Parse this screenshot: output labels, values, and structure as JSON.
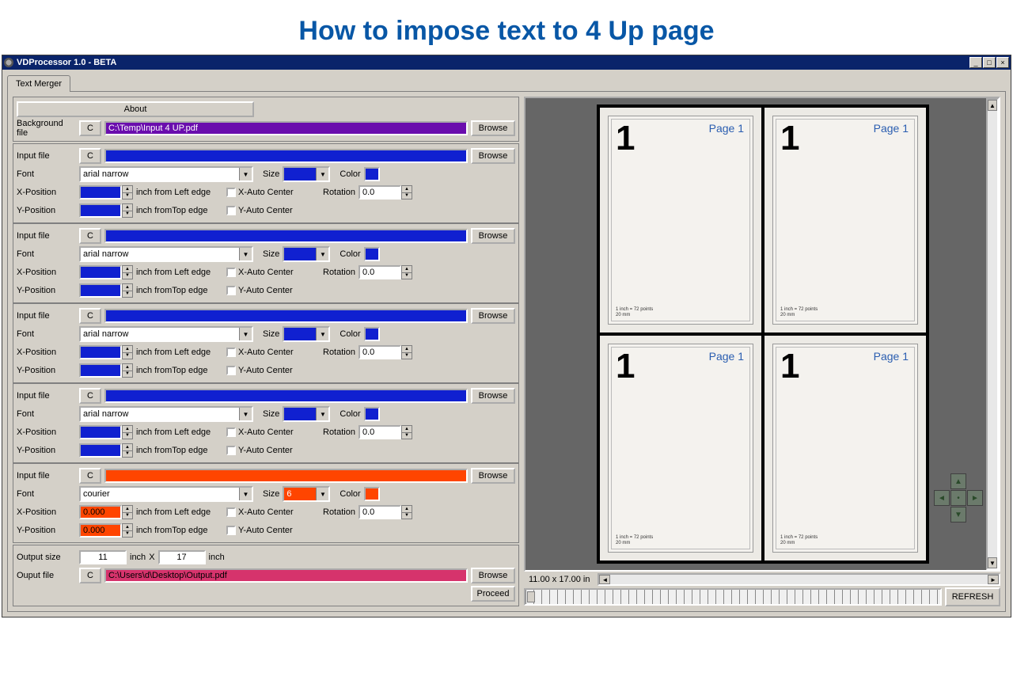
{
  "heading": "How to impose text to 4 Up page",
  "window": {
    "title": "VDProcessor 1.0 - BETA"
  },
  "tab": "Text Merger",
  "about": "About",
  "labels": {
    "background_file": "Background file",
    "input_file": "Input file",
    "font": "Font",
    "size": "Size",
    "color": "Color",
    "xpos": "X-Position",
    "ypos": "Y-Position",
    "inch_left": "inch from Left edge",
    "inch_top": "inch fromTop edge",
    "xauto": "X-Auto Center",
    "yauto": "Y-Auto Center",
    "rotation": "Rotation",
    "output_size": "Output size",
    "output_file": "Ouput file",
    "inch": "inch",
    "x": "X",
    "c": "C",
    "browse": "Browse",
    "proceed": "Proceed",
    "refresh": "REFRESH"
  },
  "background": {
    "path": "C:\\Temp\\Input 4 UP.pdf"
  },
  "inputs": [
    {
      "path": "",
      "font": "arial narrow",
      "size": "",
      "color": "#1020d0",
      "xpos": "",
      "ypos": "",
      "rotation": "0.0",
      "theme": "blue"
    },
    {
      "path": "",
      "font": "arial narrow",
      "size": "",
      "color": "#1020d0",
      "xpos": "",
      "ypos": "",
      "rotation": "0.0",
      "theme": "blue"
    },
    {
      "path": "",
      "font": "arial narrow",
      "size": "",
      "color": "#1020d0",
      "xpos": "",
      "ypos": "",
      "rotation": "0.0",
      "theme": "blue"
    },
    {
      "path": "",
      "font": "arial narrow",
      "size": "",
      "color": "#1020d0",
      "xpos": "",
      "ypos": "",
      "rotation": "0.0",
      "theme": "blue"
    },
    {
      "path": "",
      "font": "courier",
      "size": "6",
      "color": "#ff4500",
      "xpos": "0.000",
      "ypos": "0.000",
      "rotation": "0.0",
      "theme": "orange"
    }
  ],
  "output": {
    "width": "11",
    "height": "17",
    "path": "C:\\Users\\d\\Desktop\\Output.pdf"
  },
  "preview": {
    "size_label": "11.00 x 17.00 in",
    "page_number": "1",
    "page_label": "Page 1",
    "footnote1": "1 inch = 72 points",
    "footnote2": "20 mm"
  }
}
